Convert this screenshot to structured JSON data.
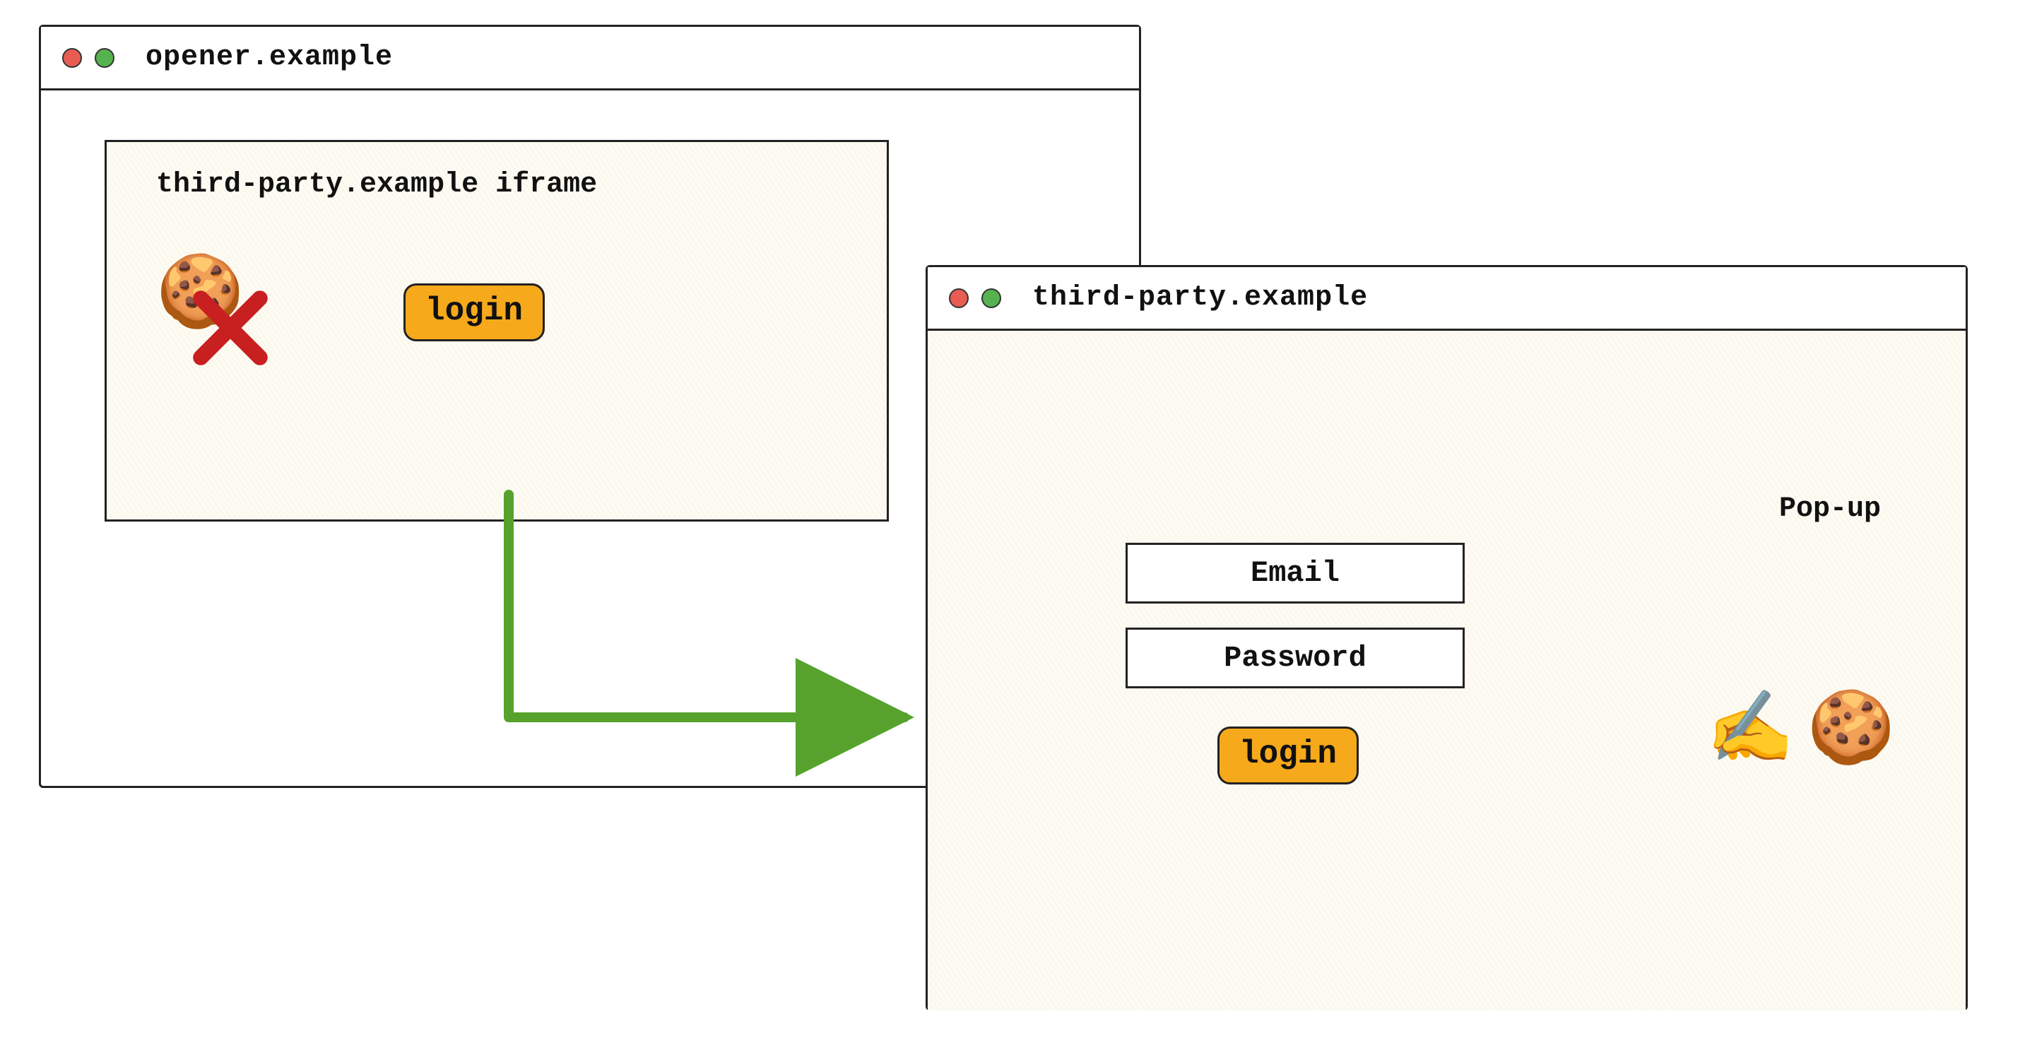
{
  "opener": {
    "title": "opener.example",
    "iframe": {
      "title": "third-party.example iframe",
      "cookie_icon": "🍪",
      "blocked": true,
      "login_label": "login"
    }
  },
  "popup": {
    "title": "third-party.example",
    "label": "Pop-up",
    "email_placeholder": "Email",
    "password_placeholder": "Password",
    "login_label": "login",
    "write_icon": "✍️",
    "cookie_icon": "🍪"
  },
  "colors": {
    "accent": "#f6a91a",
    "arrow": "#56a22d",
    "red": "#e85c54",
    "green": "#56b24e",
    "cross": "#c82020"
  }
}
